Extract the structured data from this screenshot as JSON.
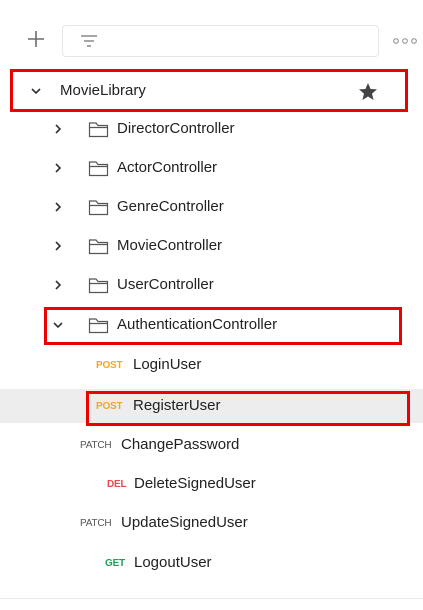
{
  "collection": {
    "name": "MovieLibrary",
    "starred": true
  },
  "folders": [
    {
      "label": "DirectorController",
      "expanded": false
    },
    {
      "label": "ActorController",
      "expanded": false
    },
    {
      "label": "GenreController",
      "expanded": false
    },
    {
      "label": "MovieController",
      "expanded": false
    },
    {
      "label": "UserController",
      "expanded": false
    },
    {
      "label": "AuthenticationController",
      "expanded": true
    }
  ],
  "requests": [
    {
      "method": "POST",
      "label": "LoginUser"
    },
    {
      "method": "POST",
      "label": "RegisterUser",
      "selected": true
    },
    {
      "method": "PATCH",
      "label": "ChangePassword"
    },
    {
      "method": "DEL",
      "label": "DeleteSignedUser"
    },
    {
      "method": "PATCH",
      "label": "UpdateSignedUser"
    },
    {
      "method": "GET",
      "label": "LogoutUser"
    }
  ],
  "colors": {
    "post": "#f5a623",
    "patch": "#555555",
    "del": "#e5484d",
    "get": "#1f9d55",
    "highlight": "#ee0000"
  },
  "icons": [
    "plus-icon",
    "filter-icon",
    "more-icon",
    "chevron-down-icon",
    "chevron-right-icon",
    "folder-icon",
    "star-icon"
  ]
}
